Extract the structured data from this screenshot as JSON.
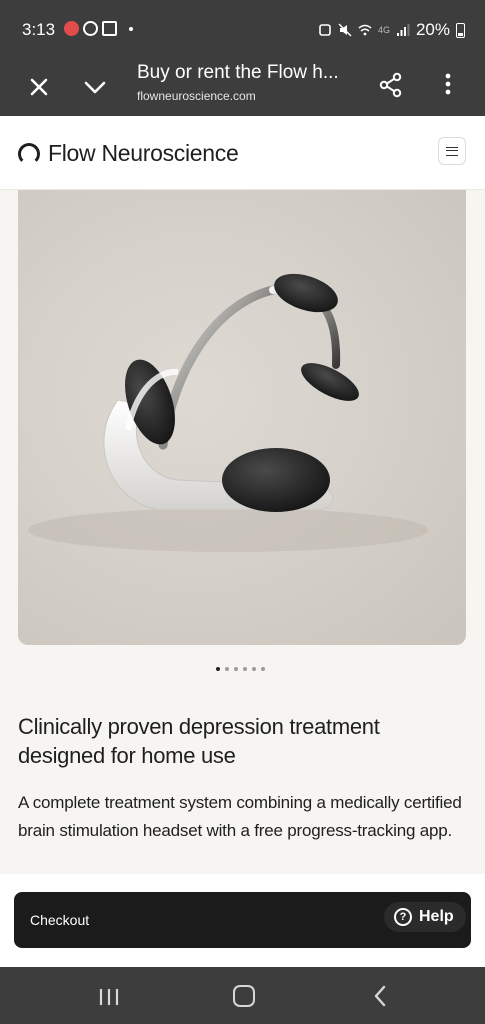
{
  "status_bar": {
    "time": "3:13",
    "network": "4G",
    "battery": "20%"
  },
  "browser": {
    "title": "Buy or rent the Flow h...",
    "url": "flowneuroscience.com"
  },
  "site": {
    "brand": "Flow Neuroscience"
  },
  "carousel": {
    "slide_count": 6,
    "active_index": 0
  },
  "content": {
    "headline": "Clinically proven depression treatment designed for home use",
    "description": "A complete treatment system combining a medically certified brain stimulation headset with a free progress-tracking app."
  },
  "checkout": {
    "label": "Checkout",
    "help_label": "Help"
  },
  "icons": {
    "close": "close-icon",
    "collapse": "chevron-down-icon",
    "share": "share-icon",
    "more": "more-vert-icon",
    "menu": "hamburger-icon",
    "help": "help-circle-icon",
    "recent": "recent-apps-icon",
    "home": "home-icon",
    "back": "back-icon"
  }
}
